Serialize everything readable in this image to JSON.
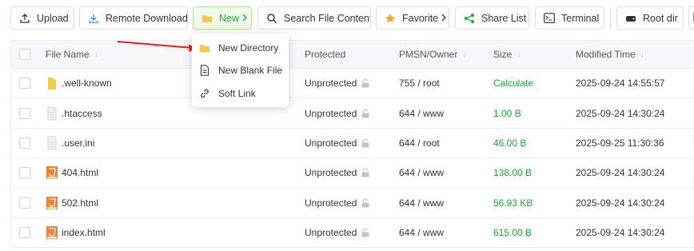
{
  "toolbar": {
    "upload": "Upload",
    "remote_download": "Remote Download",
    "new": "New",
    "search_file_content": "Search File Content",
    "favorite": "Favorite",
    "share_list": "Share List",
    "terminal": "Terminal",
    "root_dir": "Root dir"
  },
  "dropdown": {
    "items": [
      {
        "label": "New Directory",
        "icon": "folder-icon"
      },
      {
        "label": "New Blank File",
        "icon": "file-icon"
      },
      {
        "label": "Soft Link",
        "icon": "link-icon"
      }
    ]
  },
  "table": {
    "headers": {
      "file_name": "File Name",
      "protected": "Protected",
      "pmsn_owner": "PMSN/Owner",
      "size": "Size",
      "modified_time": "Modified Time"
    },
    "rows": [
      {
        "name": ".well-known",
        "type": "folder",
        "protected": "Unprotected",
        "perm": "755 / root",
        "size": "Calculate",
        "modified": "2025-09-24 14:55:57"
      },
      {
        "name": ".htaccess",
        "type": "file",
        "protected": "Unprotected",
        "perm": "644 / www",
        "size": "1.00 B",
        "modified": "2025-09-24 14:30:24"
      },
      {
        "name": ".user.ini",
        "type": "file",
        "protected": "Unprotected",
        "perm": "644 / root",
        "size": "46.00 B",
        "modified": "2025-09-25 11:30:36"
      },
      {
        "name": "404.html",
        "type": "html",
        "protected": "Unprotected",
        "perm": "644 / www",
        "size": "138.00 B",
        "modified": "2025-09-24 14:30:24"
      },
      {
        "name": "502.html",
        "type": "html",
        "protected": "Unprotected",
        "perm": "644 / www",
        "size": "56.93 KB",
        "modified": "2025-09-24 14:30:24"
      },
      {
        "name": "index.html",
        "type": "html",
        "protected": "Unprotected",
        "perm": "644 / www",
        "size": "615.00 B",
        "modified": "2025-09-24 14:30:24"
      }
    ]
  },
  "colors": {
    "accent_green": "#20a53a",
    "folder_yellow": "#f7c948",
    "html_orange": "#e8833a",
    "arrow_red": "#e02020"
  }
}
